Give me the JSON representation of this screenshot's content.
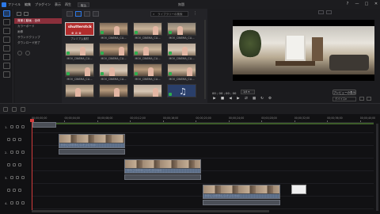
{
  "titlebar": {
    "menus": [
      "ファイル",
      "編集",
      "プラグイン",
      "表示",
      "再生"
    ],
    "mode": "取込",
    "title": "無題",
    "controls": [
      "?",
      "—",
      "□",
      "✕"
    ]
  },
  "categories": {
    "items": [
      "背景と動画 - 全体",
      "カラーボード",
      "画像",
      "サウンドクリップ",
      "ダウンロード完了"
    ],
    "selected_index": 0
  },
  "library": {
    "search_placeholder": "ライブラリーの検索",
    "tiles": [
      {
        "label": "プレミアム素材",
        "kind": "shutterstock",
        "brand": "shutterstck",
        "icons": "⊕ ⊘ ⊗",
        "checked": false
      },
      {
        "label": "MOV_CINEMA_CLI...",
        "kind": "video",
        "scene": "scene-a",
        "checked": true
      },
      {
        "label": "MOV_CINEMA_CLI...",
        "kind": "video",
        "scene": "scene-b",
        "checked": true
      },
      {
        "label": "MOV_CINEMA_CLI...",
        "kind": "video",
        "scene": "scene-c",
        "checked": true
      },
      {
        "label": "MOV_CINEMA_CLI...",
        "kind": "video",
        "scene": "scene-d",
        "checked": true
      },
      {
        "label": "MOV_CINEMA_CLI...",
        "kind": "video",
        "scene": "scene-a",
        "checked": true
      },
      {
        "label": "MOV_CINEMA_CLI...",
        "kind": "video",
        "scene": "scene-b",
        "checked": true
      },
      {
        "label": "MOV_CINEMA_CLI...",
        "kind": "video",
        "scene": "scene-d",
        "checked": true
      },
      {
        "label": "MOV_CINEMA_CLI...",
        "kind": "video",
        "scene": "scene-c",
        "checked": true
      },
      {
        "label": "MOV_CINEMA_CLI...",
        "kind": "video",
        "scene": "scene-d",
        "checked": true
      },
      {
        "label": "MOV_CINEMA_CLI...",
        "kind": "video",
        "scene": "scene-a",
        "checked": true
      },
      {
        "label": "MOV_CINEMA_CLI...",
        "kind": "video",
        "scene": "scene-b",
        "checked": true
      },
      {
        "label": "",
        "kind": "video",
        "scene": "scene-b",
        "checked": false
      },
      {
        "label": "",
        "kind": "video",
        "scene": "scene-a",
        "checked": false
      },
      {
        "label": "",
        "kind": "video",
        "scene": "scene-d",
        "checked": false
      },
      {
        "label": "",
        "kind": "music",
        "checked": true
      }
    ]
  },
  "preview": {
    "timecode": "00 ; 00 ; 00 ; 00",
    "quality": "1/4 ▾",
    "preview_button": "プレビューの表示",
    "mode_select": "デバイス▾",
    "transport": [
      "▶",
      "■",
      "◀",
      "▶",
      "⇄",
      "▦",
      "↻",
      "⚙"
    ]
  },
  "timeline": {
    "ruler_labels": [
      "00;00;00;00",
      "00;00;04;00",
      "00;00;08;00",
      "00;00;12;00",
      "00;00;16;00",
      "00;00;20;00",
      "00;00;24;00",
      "00;00;28;00",
      "00;00;32;00",
      "00;00;36;00",
      "00;00;40;00"
    ],
    "tracks": [
      "1.",
      "",
      "2.",
      "",
      "3.",
      "",
      "4.",
      "",
      "5."
    ],
    "clips": [
      {
        "label": "MOV_CINEMA_CLIP_01.mp4"
      },
      {
        "label": "MOV_CINEMA_CLIP_02.mp4"
      },
      {
        "label": "MOV_CINEMA_CLIP_03.mp4"
      }
    ]
  }
}
